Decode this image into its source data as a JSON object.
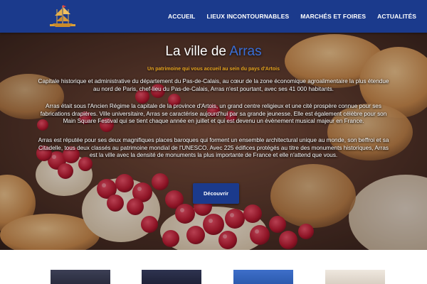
{
  "nav": {
    "items": [
      {
        "label": "ACCUEIL"
      },
      {
        "label": "LIEUX INCONTOURNABLES"
      },
      {
        "label": "MARCHÉS ET FOIRES"
      },
      {
        "label": "ACTUALITÉS"
      }
    ]
  },
  "hero": {
    "title_prefix": "La ville de",
    "title_accent": "Arras",
    "subtitle": "Un patrimoine qui vous accueil au sein du pays d'Artois",
    "paragraphs": [
      "Capitale historique et administrative du département du Pas-de-Calais, au cœur de la zone économique agroalimentaire la plus étendue au nord de Paris, chef-lieu du Pas-de-Calais, Arras n'est pourtant, avec ses 41 000 habitants.",
      "Arras était sous l'Ancien Régime la capitale de la province d'Artois, un grand centre religieux et une cité prospère connue pour ses fabrications drapières. Ville universitaire, Arras se caractérise aujourd'hui par sa grande jeunesse. Elle est également célèbre pour son Main Square Festival qui se tient chaque année en juillet et qui est devenu un évènement musical majeur en France.",
      "Arras est réputée pour ses deux magnifiques places baroques qui forment un ensemble architectural unique au monde, son beffroi et sa Citadelle, tous deux classés au patrimoine mondial de l'UNESCO. Avec 225 édifices protégés au titre des monuments historiques, Arras est la ville avec la densité de monuments la plus importante de France et elle n'attend que vous."
    ],
    "cta_label": "Découvrir"
  },
  "colors": {
    "nav_background": "#1b3a8c",
    "title_accent": "#3a6fd8",
    "subtitle": "#e3a21f",
    "button": "#1b3a8c"
  },
  "icons": {
    "logo": "ship-logo-icon"
  }
}
